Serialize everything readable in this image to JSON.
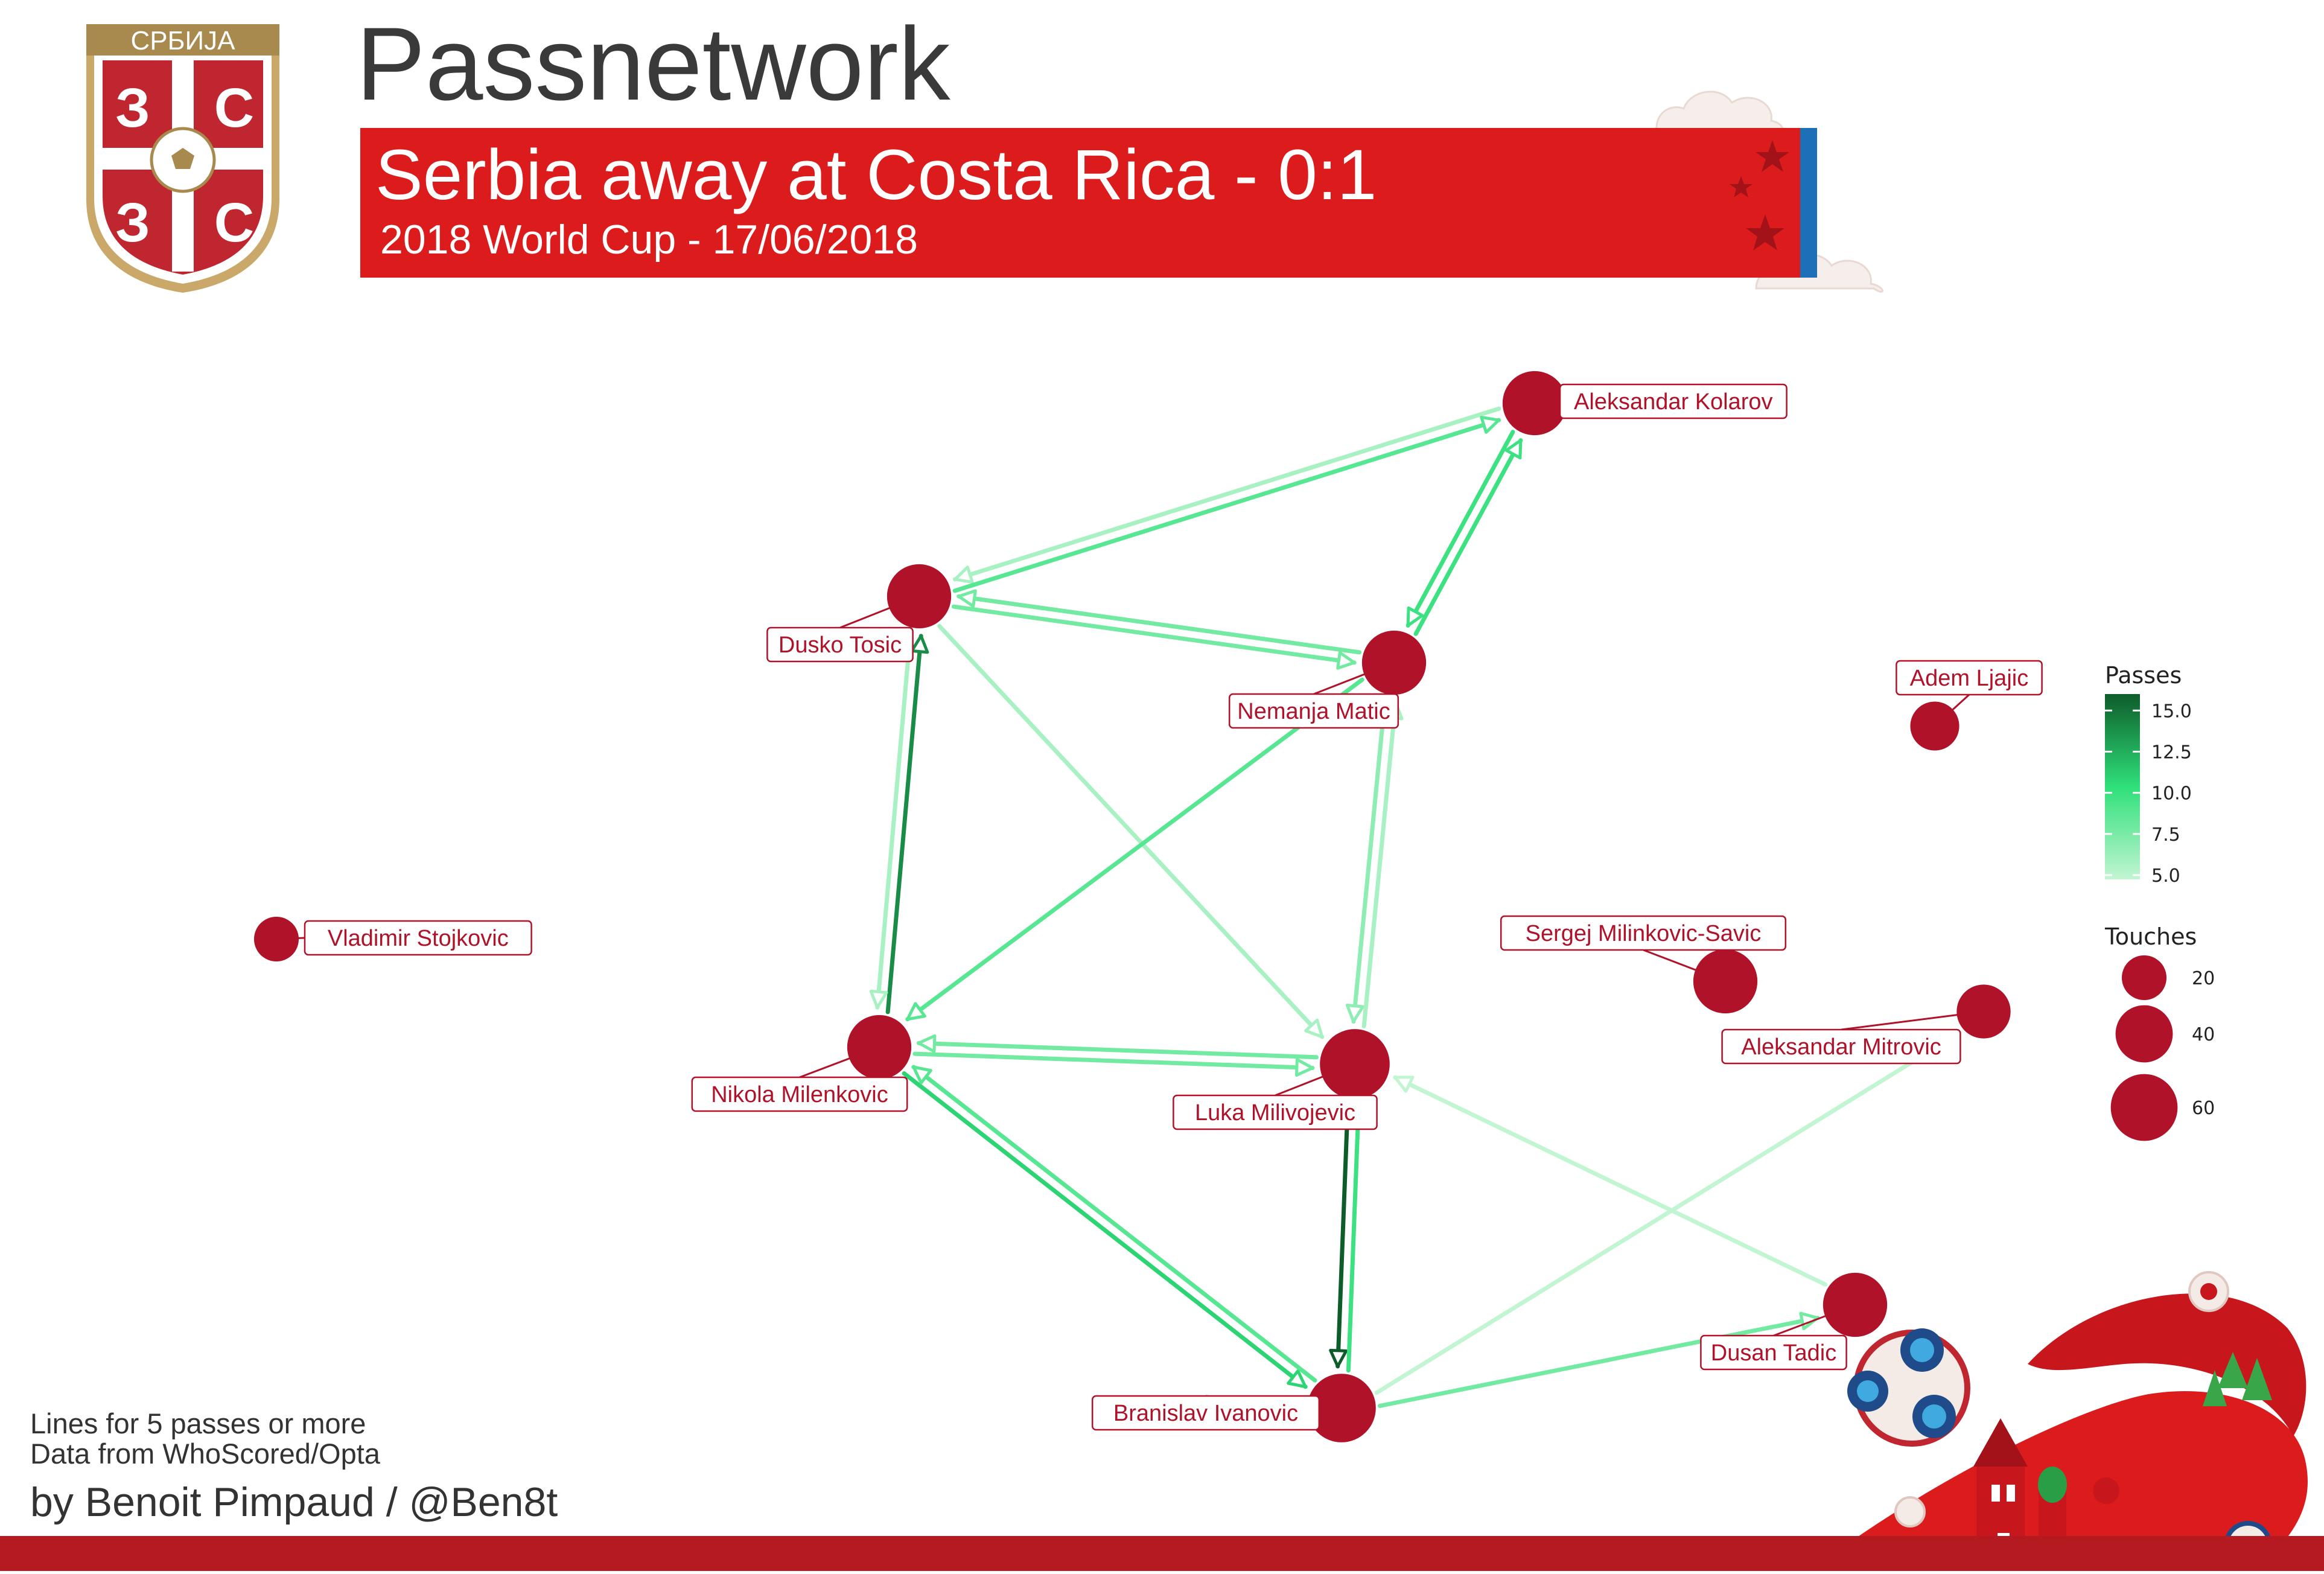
{
  "header": {
    "title": "Passnetwork",
    "banner_title": "Serbia away at Costa Rica - 0:1",
    "banner_subtitle": "2018 World Cup - 17/06/2018",
    "crest_text": "СРБИЈА"
  },
  "footer": {
    "note_1": "Lines for 5 passes or more",
    "note_2": "Data from WhoScored/Opta",
    "credit": "by Benoit Pimpaud / @Ben8t"
  },
  "colors": {
    "node": "#b0122a",
    "banner_red": "#dc1c1c",
    "banner_blue": "#1d6fb8",
    "pass_low": "#c2f5d2",
    "pass_mid": "#2fe07a",
    "pass_high": "#0d5c2a"
  },
  "legend": {
    "passes_title": "Passes",
    "passes_ticks": [
      "15.0",
      "12.5",
      "10.0",
      "7.5",
      "5.0"
    ],
    "touches_title": "Touches",
    "touches_ticks": [
      "20",
      "40",
      "60"
    ]
  },
  "players": [
    {
      "id": "kolarov",
      "name": "Aleksandar Kolarov",
      "touches": 54
    },
    {
      "id": "tosic",
      "name": "Dusko Tosic",
      "touches": 54
    },
    {
      "id": "matic",
      "name": "Nemanja Matic",
      "touches": 54
    },
    {
      "id": "ljajic",
      "name": "Adem Ljajic",
      "touches": 26
    },
    {
      "id": "stojkovic",
      "name": "Vladimir Stojkovic",
      "touches": 20
    },
    {
      "id": "milinkovic",
      "name": "Sergej Milinkovic-Savic",
      "touches": 54
    },
    {
      "id": "mitrovic",
      "name": "Aleksandar Mitrovic",
      "touches": 34
    },
    {
      "id": "milenkovic",
      "name": "Nikola Milenkovic",
      "touches": 54
    },
    {
      "id": "milivojevic",
      "name": "Luka Milivojevic",
      "touches": 67
    },
    {
      "id": "tadic",
      "name": "Dusan Tadic",
      "touches": 54
    },
    {
      "id": "ivanovic",
      "name": "Branislav Ivanovic",
      "touches": 64
    }
  ],
  "passes": [
    {
      "from": "kolarov",
      "to": "tosic",
      "count": 6
    },
    {
      "from": "tosic",
      "to": "kolarov",
      "count": 9
    },
    {
      "from": "kolarov",
      "to": "matic",
      "count": 10
    },
    {
      "from": "matic",
      "to": "kolarov",
      "count": 10
    },
    {
      "from": "tosic",
      "to": "matic",
      "count": 8
    },
    {
      "from": "matic",
      "to": "tosic",
      "count": 8
    },
    {
      "from": "milenkovic",
      "to": "tosic",
      "count": 14
    },
    {
      "from": "tosic",
      "to": "milenkovic",
      "count": 6
    },
    {
      "from": "tosic",
      "to": "milivojevic",
      "count": 6
    },
    {
      "from": "matic",
      "to": "milenkovic",
      "count": 9
    },
    {
      "from": "matic",
      "to": "milivojevic",
      "count": 7
    },
    {
      "from": "milivojevic",
      "to": "matic",
      "count": 6
    },
    {
      "from": "milenkovic",
      "to": "milivojevic",
      "count": 8
    },
    {
      "from": "milivojevic",
      "to": "milenkovic",
      "count": 8
    },
    {
      "from": "milenkovic",
      "to": "ivanovic",
      "count": 11
    },
    {
      "from": "ivanovic",
      "to": "milenkovic",
      "count": 9
    },
    {
      "from": "milivojevic",
      "to": "ivanovic",
      "count": 16
    },
    {
      "from": "ivanovic",
      "to": "milivojevic",
      "count": 10
    },
    {
      "from": "ivanovic",
      "to": "tadic",
      "count": 8
    },
    {
      "from": "tadic",
      "to": "milivojevic",
      "count": 5
    },
    {
      "from": "ivanovic",
      "to": "mitrovic",
      "count": 5
    }
  ]
}
